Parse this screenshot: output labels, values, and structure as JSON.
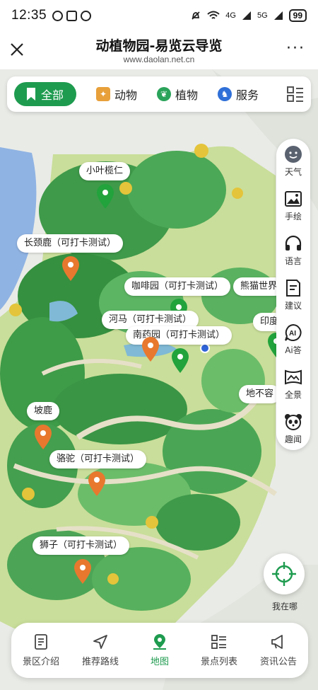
{
  "status_bar": {
    "time": "12:35",
    "signal_1": "4G",
    "signal_2": "5G",
    "battery": "99"
  },
  "header": {
    "title": "动植物园-易览云导览",
    "subtitle": "www.daolan.net.cn",
    "more": "···"
  },
  "categories": [
    {
      "label": "全部",
      "icon": "bookmark-icon",
      "active": true
    },
    {
      "label": "动物",
      "icon": "deer-icon",
      "active": false
    },
    {
      "label": "植物",
      "icon": "sprout-icon",
      "active": false
    },
    {
      "label": "服务",
      "icon": "service-icon",
      "active": false
    }
  ],
  "side_tools": [
    {
      "label": "天气",
      "icon": "weather-icon"
    },
    {
      "label": "手绘",
      "icon": "image-icon"
    },
    {
      "label": "语言",
      "icon": "headphones-icon"
    },
    {
      "label": "建议",
      "icon": "feedback-icon"
    },
    {
      "label": "Ai答",
      "icon": "ai-icon"
    },
    {
      "label": "全景",
      "icon": "panorama-icon"
    },
    {
      "label": "趣闻",
      "icon": "panda-icon"
    }
  ],
  "map_labels": {
    "xiaoye": "小叶榄仁",
    "changjinglu": "长颈鹿（可打卡测试）",
    "kafei": "咖啡园（可打卡测试）",
    "xiongmao": "熊猫世界",
    "hema": "河马（可打卡测试）",
    "nanyao": "南药园（可打卡测试）",
    "yin": "印度",
    "podi": "地不容",
    "polu": "坡鹿",
    "luotuo": "骆驼（可打卡测试）",
    "shizi": "狮子（可打卡测试）"
  },
  "colors": {
    "accent": "#1e9b4f",
    "pin_green": "#22a33c",
    "pin_orange": "#e8782e"
  },
  "locate": {
    "label": "我在哪"
  },
  "bottom_nav": [
    {
      "label": "景区介绍",
      "icon": "document-icon",
      "active": false
    },
    {
      "label": "推荐路线",
      "icon": "navigation-icon",
      "active": false
    },
    {
      "label": "地图",
      "icon": "map-pin-icon",
      "active": true
    },
    {
      "label": "景点列表",
      "icon": "list-icon",
      "active": false
    },
    {
      "label": "资讯公告",
      "icon": "megaphone-icon",
      "active": false
    }
  ]
}
